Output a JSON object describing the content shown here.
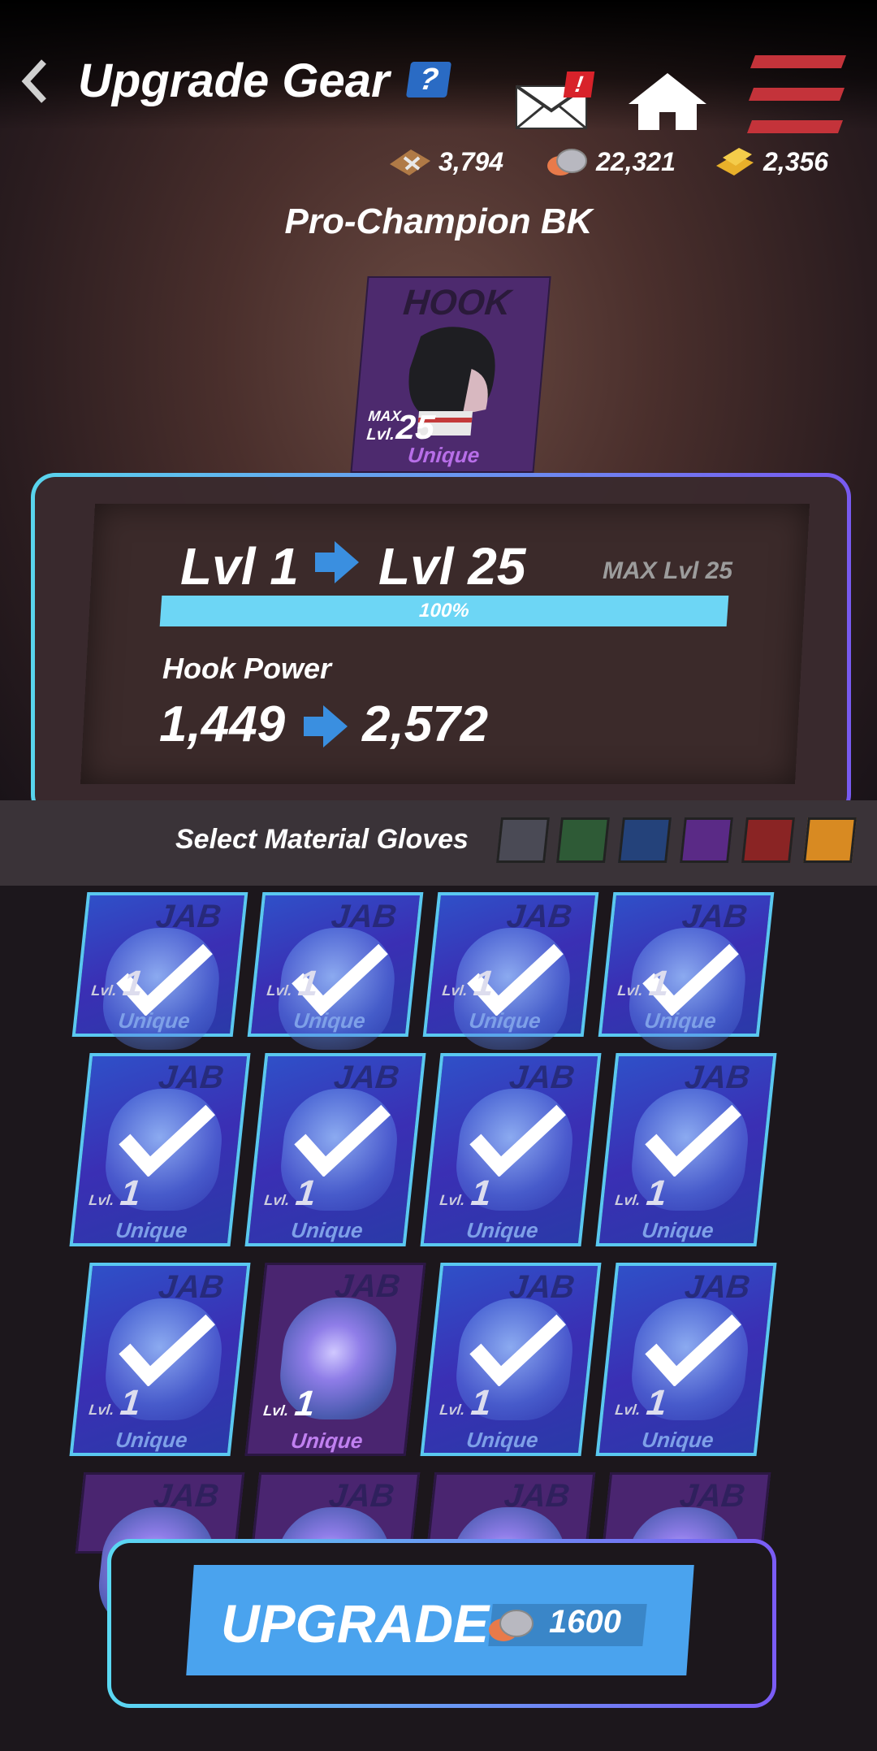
{
  "header": {
    "title": "Upgrade Gear",
    "help_label": "?",
    "mail_alert": "!"
  },
  "currencies": [
    {
      "icon": "tool-kit-icon",
      "value": "3,794"
    },
    {
      "icon": "coin-icon",
      "value": "22,321"
    },
    {
      "icon": "gold-bar-icon",
      "value": "2,356"
    }
  ],
  "champion": "Pro-Champion BK",
  "gear_card": {
    "type": "HOOK",
    "max_label": "MAX",
    "lvl_label": "Lvl.",
    "level": "25",
    "rarity": "Unique"
  },
  "upgrade": {
    "from_level": "Lvl 1",
    "to_level": "Lvl 25",
    "max_level": "MAX Lvl 25",
    "progress_label": "100%",
    "progress": 1.0,
    "stat_name": "Hook Power",
    "stat_from": "1,449",
    "stat_to": "2,572"
  },
  "material": {
    "label": "Select Material Gloves",
    "filters": [
      "#4a4a55",
      "#2e5a36",
      "#24427a",
      "#5a2a86",
      "#8a2424",
      "#d88a22"
    ]
  },
  "gloves": [
    {
      "jab": "JAB",
      "lvl": "Lvl.",
      "num": "1",
      "rarity": "Unique",
      "selected": true
    },
    {
      "jab": "JAB",
      "lvl": "Lvl.",
      "num": "1",
      "rarity": "Unique",
      "selected": true
    },
    {
      "jab": "JAB",
      "lvl": "Lvl.",
      "num": "1",
      "rarity": "Unique",
      "selected": true
    },
    {
      "jab": "JAB",
      "lvl": "Lvl.",
      "num": "1",
      "rarity": "Unique",
      "selected": true
    },
    {
      "jab": "JAB",
      "lvl": "Lvl.",
      "num": "1",
      "rarity": "Unique",
      "selected": true
    },
    {
      "jab": "JAB",
      "lvl": "Lvl.",
      "num": "1",
      "rarity": "Unique",
      "selected": true
    },
    {
      "jab": "JAB",
      "lvl": "Lvl.",
      "num": "1",
      "rarity": "Unique",
      "selected": true
    },
    {
      "jab": "JAB",
      "lvl": "Lvl.",
      "num": "1",
      "rarity": "Unique",
      "selected": true
    },
    {
      "jab": "JAB",
      "lvl": "Lvl.",
      "num": "1",
      "rarity": "Unique",
      "selected": true
    },
    {
      "jab": "JAB",
      "lvl": "Lvl.",
      "num": "1",
      "rarity": "Unique",
      "selected": false
    },
    {
      "jab": "JAB",
      "lvl": "Lvl.",
      "num": "1",
      "rarity": "Unique",
      "selected": true
    },
    {
      "jab": "JAB",
      "lvl": "Lvl.",
      "num": "1",
      "rarity": "Unique",
      "selected": true
    },
    {
      "jab": "JAB",
      "lvl": "",
      "num": "",
      "rarity": "",
      "selected": false
    },
    {
      "jab": "JAB",
      "lvl": "",
      "num": "",
      "rarity": "",
      "selected": false
    },
    {
      "jab": "JAB",
      "lvl": "",
      "num": "",
      "rarity": "",
      "selected": false
    },
    {
      "jab": "JAB",
      "lvl": "",
      "num": "",
      "rarity": "",
      "selected": false
    }
  ],
  "upgrade_button": {
    "label": "UPGRADE",
    "cost": "1600",
    "cost_icon": "coin-icon"
  },
  "colors": {
    "accent_blue": "#4aa3ee",
    "progress": "#6dd6f5",
    "unique_purple": "#b76ee8"
  }
}
